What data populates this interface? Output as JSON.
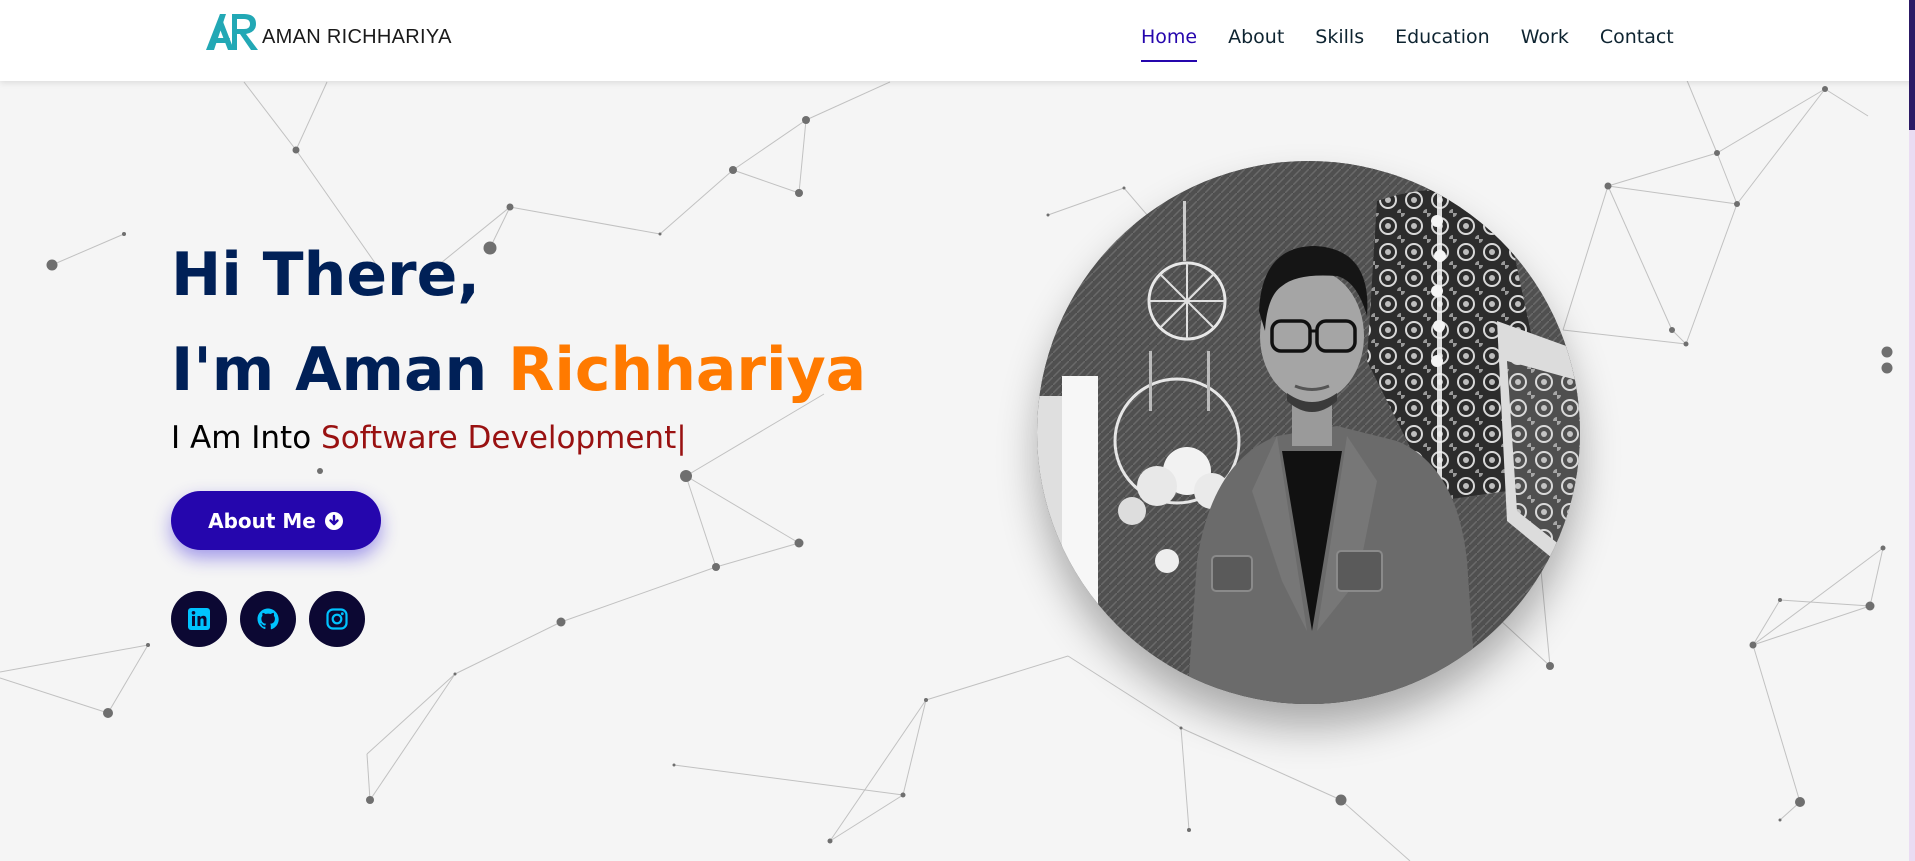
{
  "header": {
    "logo_mark": "AR",
    "logo_text": "AMAN RICHHARIYA",
    "nav": [
      "Home",
      "About",
      "Skills",
      "Education",
      "Work",
      "Contact"
    ],
    "active": "Home"
  },
  "hero": {
    "greeting_line1": "Hi There,",
    "greeting_prefix": "I'm Aman ",
    "greeting_accent": "Richhariya",
    "typed_prefix": "I Am Into ",
    "typed_role": "Software Development",
    "typed_cursor": "|",
    "button_label": "About Me",
    "socials": [
      "linkedin-icon",
      "github-icon",
      "instagram-icon"
    ]
  },
  "colors": {
    "navy": "#002057",
    "orange": "#ff7a00",
    "role_red": "#991111",
    "button": "#2506ad",
    "social_bg": "#0c0833",
    "social_icon": "#00c3ff",
    "logo_teal": "#22a8b5"
  }
}
